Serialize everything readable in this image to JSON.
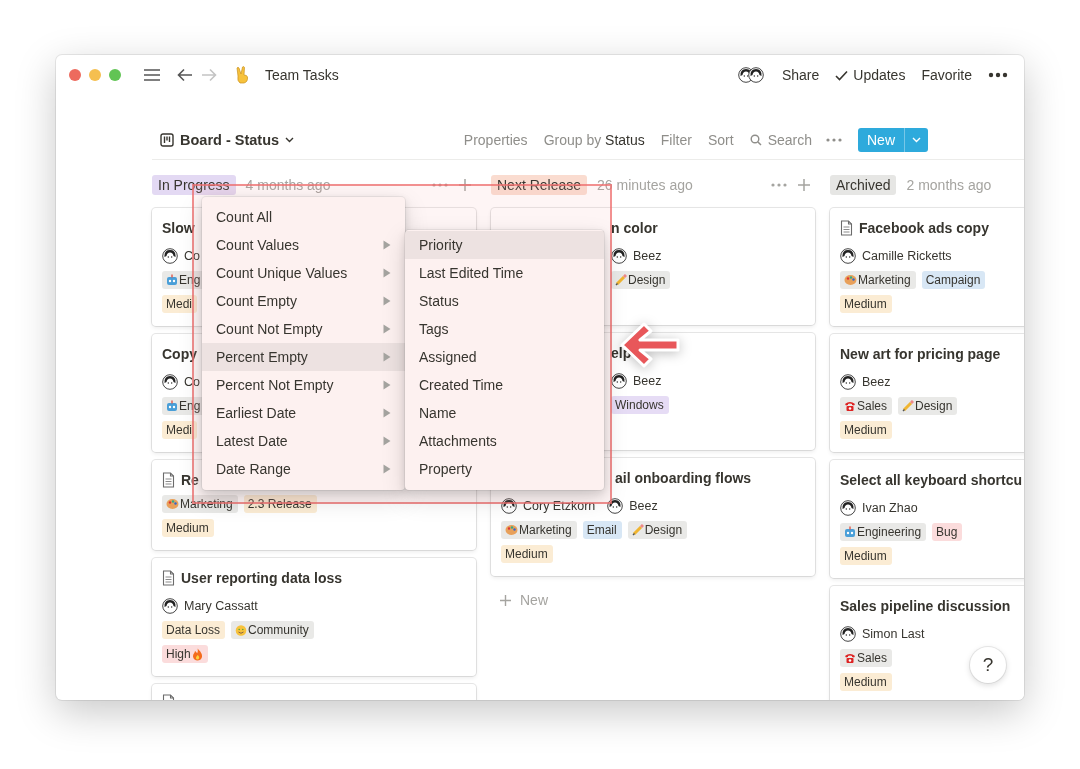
{
  "window": {
    "title": "Team Tasks",
    "share": "Share",
    "updates": "Updates",
    "favorite": "Favorite"
  },
  "toolbar": {
    "view": "Board - Status",
    "properties": "Properties",
    "group_by": "Group by **Status**",
    "filter": "Filter",
    "sort": "Sort",
    "search": "Search",
    "new_button": "New"
  },
  "columns": [
    {
      "status": "In Progress",
      "color": "#e3d9f3",
      "edited": "4 months ago",
      "controls": true,
      "cards": [
        {
          "kind": "full",
          "doc_icon": false,
          "title": "Slow",
          "people": [
            {
              "name": "Co"
            }
          ],
          "tag_rows": [
            [
              {
                "label": "Eng",
                "color": "#e9e9e7",
                "kind": "robot"
              }
            ],
            [
              {
                "label": "Medi",
                "color": "#fbecd4"
              }
            ]
          ]
        },
        {
          "kind": "full",
          "doc_icon": false,
          "title": "Copy",
          "people": [
            {
              "name": "Co"
            }
          ],
          "tag_rows": [
            [
              {
                "label": "Eng",
                "color": "#e9e9e7",
                "kind": "robot"
              }
            ],
            [
              {
                "label": "Medi",
                "color": "#fbecd4"
              }
            ]
          ]
        },
        {
          "kind": "full",
          "doc_icon": true,
          "title": "Re",
          "tag_rows": [
            [
              {
                "label": "Marketing",
                "color": "#e9e9e7",
                "kind": "palette"
              },
              {
                "label": "2.3 Release",
                "color": "#fbecd4"
              }
            ],
            [
              {
                "label": "Medium",
                "color": "#fbecd4"
              }
            ]
          ]
        },
        {
          "kind": "full",
          "doc_icon": true,
          "title": "User reporting data loss",
          "people": [
            {
              "name": "Mary Cassatt"
            }
          ],
          "tag_rows": [
            [
              {
                "label": "Data Loss",
                "color": "#fbecd4"
              },
              {
                "label": "Community",
                "color": "#e9e9e7",
                "kind": "smiley"
              }
            ],
            [
              {
                "label": "High",
                "color": "#fbdcdc",
                "kind": "fire"
              }
            ]
          ]
        },
        {
          "kind": "full",
          "doc_icon": true
        }
      ]
    },
    {
      "status": "Next Release",
      "color": "#fadcd0",
      "edited": "26 minutes ago",
      "controls": true,
      "cards": [
        {
          "kind": "covered",
          "doc_icon": false,
          "title": "n color",
          "people": [
            {
              "name": "Beez"
            }
          ],
          "tag_rows": [
            [
              {
                "label": "Design",
                "color": "#e9e9e7",
                "kind": "pencil"
              }
            ]
          ]
        },
        {
          "kind": "covered",
          "doc_icon": false,
          "title": "elp",
          "people": [
            {
              "name": "Beez"
            }
          ],
          "tag_rows": [
            [
              {
                "label": "Windows",
                "color": "#e6dcf5"
              }
            ]
          ]
        },
        {
          "kind": "title-covered",
          "doc_icon": false,
          "title": "ail onboarding flows",
          "people": [
            {
              "name": "Cory Etzkorn"
            },
            {
              "name": "Beez"
            }
          ],
          "tag_rows": [
            [
              {
                "label": "Marketing",
                "color": "#e9e9e7",
                "kind": "palette"
              },
              {
                "label": "Email",
                "color": "#d8e7f5"
              },
              {
                "label": "Design",
                "color": "#e9e9e7",
                "kind": "pencil"
              }
            ],
            [
              {
                "label": "Medium",
                "color": "#fbecd4"
              }
            ]
          ]
        }
      ],
      "add_new": "New"
    },
    {
      "status": "Archived",
      "color": "#e6e6e4",
      "edited": "2 months ago",
      "controls": false,
      "cards": [
        {
          "kind": "full",
          "doc_icon": true,
          "title": "Facebook ads copy",
          "people": [
            {
              "name": "Camille Ricketts"
            }
          ],
          "tag_rows": [
            [
              {
                "label": "Marketing",
                "color": "#e9e9e7",
                "kind": "palette"
              },
              {
                "label": "Campaign",
                "color": "#d8e7f5"
              }
            ],
            [
              {
                "label": "Medium",
                "color": "#fbecd4"
              }
            ]
          ]
        },
        {
          "kind": "full",
          "doc_icon": false,
          "title": "New art for pricing page",
          "people": [
            {
              "name": "Beez"
            }
          ],
          "tag_rows": [
            [
              {
                "label": "Sales",
                "color": "#e9e9e7",
                "kind": "phone"
              },
              {
                "label": "Design",
                "color": "#e9e9e7",
                "kind": "pencil"
              }
            ],
            [
              {
                "label": "Medium",
                "color": "#fbecd4"
              }
            ]
          ]
        },
        {
          "kind": "full",
          "doc_icon": false,
          "title": "Select all keyboard shortcu",
          "people": [
            {
              "name": "Ivan Zhao"
            }
          ],
          "tag_rows": [
            [
              {
                "label": "Engineering",
                "color": "#e9e9e7",
                "kind": "robot"
              },
              {
                "label": "Bug",
                "color": "#fbdcdc"
              }
            ],
            [
              {
                "label": "Medium",
                "color": "#fbecd4"
              }
            ]
          ]
        },
        {
          "kind": "full",
          "doc_icon": false,
          "title": "Sales pipeline discussion",
          "people": [
            {
              "name": "Simon Last"
            }
          ],
          "tag_rows": [
            [
              {
                "label": "Sales",
                "color": "#e9e9e7",
                "kind": "phone"
              }
            ],
            [
              {
                "label": "Medium",
                "color": "#fbecd4"
              }
            ]
          ]
        }
      ]
    }
  ],
  "menu": {
    "items": [
      {
        "label": "Count All",
        "submenu": false,
        "selected": false
      },
      {
        "label": "Count Values",
        "submenu": true,
        "selected": false
      },
      {
        "label": "Count Unique Values",
        "submenu": true,
        "selected": false
      },
      {
        "label": "Count Empty",
        "submenu": true,
        "selected": false
      },
      {
        "label": "Count Not Empty",
        "submenu": true,
        "selected": false
      },
      {
        "label": "Percent Empty",
        "submenu": true,
        "selected": true
      },
      {
        "label": "Percent Not Empty",
        "submenu": true,
        "selected": false
      },
      {
        "label": "Earliest Date",
        "submenu": true,
        "selected": false
      },
      {
        "label": "Latest Date",
        "submenu": true,
        "selected": false
      },
      {
        "label": "Date Range",
        "submenu": true,
        "selected": false
      }
    ],
    "submenu": [
      {
        "label": "Priority",
        "selected": true
      },
      {
        "label": "Last Edited Time",
        "selected": false
      },
      {
        "label": "Status",
        "selected": false
      },
      {
        "label": "Tags",
        "selected": false
      },
      {
        "label": "Assigned",
        "selected": false
      },
      {
        "label": "Created Time",
        "selected": false
      },
      {
        "label": "Name",
        "selected": false
      },
      {
        "label": "Attachments",
        "selected": false
      },
      {
        "label": "Property",
        "selected": false
      }
    ]
  },
  "help_button": "?"
}
